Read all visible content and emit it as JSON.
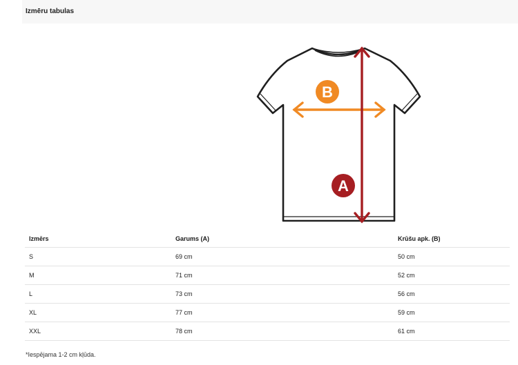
{
  "header": {
    "title": "Izmēru tabulas"
  },
  "diagram": {
    "label_b": "B",
    "label_a": "A",
    "colors": {
      "b_accent": "#f08a24",
      "a_accent": "#a61e22"
    }
  },
  "table": {
    "headers": [
      "Izmērs",
      "Garums (A)",
      "Krūšu apk. (B)"
    ],
    "rows": [
      [
        "S",
        "69 cm",
        "50 cm"
      ],
      [
        "M",
        "71 cm",
        "52 cm"
      ],
      [
        "L",
        "73 cm",
        "56 cm"
      ],
      [
        "XL",
        "77 cm",
        "59 cm"
      ],
      [
        "XXL",
        "78 cm",
        "61 cm"
      ]
    ]
  },
  "footnote": "*Iespējama 1-2 cm kļūda."
}
